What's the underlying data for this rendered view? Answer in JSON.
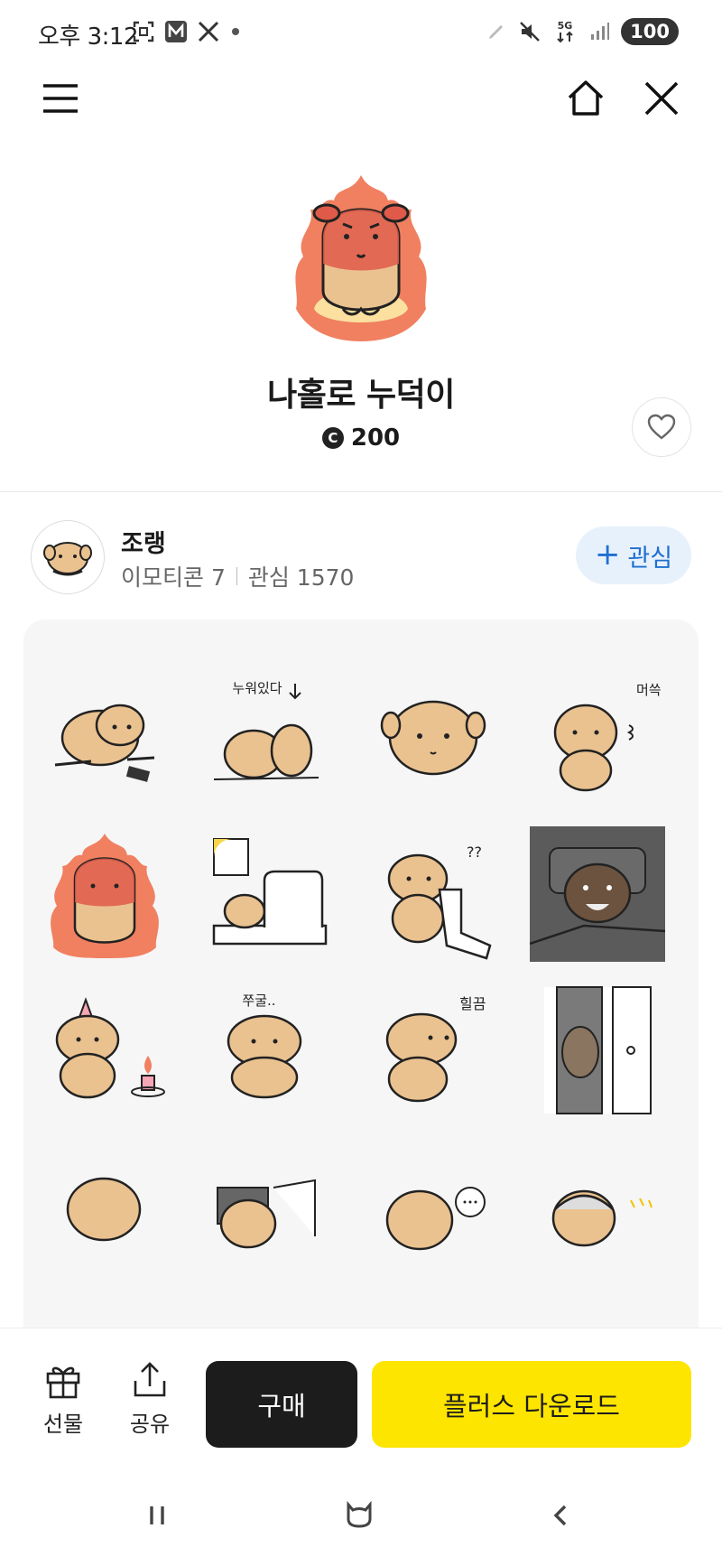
{
  "status_bar": {
    "time": "오후 3:12",
    "network": "5G",
    "battery": "100"
  },
  "product": {
    "title": "나홀로 누덕이",
    "price_icon": "C",
    "price": "200"
  },
  "creator": {
    "name": "조랭",
    "emoticon_count_label": "이모티콘 7",
    "follower_label": "관심 1570",
    "follow_button_label": "관심"
  },
  "stickers": {
    "cells": [
      {
        "icon": "puppy-lying-with-phone"
      },
      {
        "icon": "puppy-lying-down",
        "caption": "누워있다"
      },
      {
        "icon": "puppy-face"
      },
      {
        "icon": "puppy-sweating",
        "caption": "머쓱"
      },
      {
        "icon": "puppy-angry-fire"
      },
      {
        "icon": "puppy-in-bed-sun"
      },
      {
        "icon": "puppy-holding-sock",
        "caption": "??"
      },
      {
        "icon": "puppy-dark-room"
      },
      {
        "icon": "puppy-birthday-candle"
      },
      {
        "icon": "puppy-shrinking",
        "caption": "쭈굴.."
      },
      {
        "icon": "puppy-glancing",
        "caption": "힐끔"
      },
      {
        "icon": "puppy-in-doorway"
      },
      {
        "icon": "puppy-partial-1"
      },
      {
        "icon": "puppy-partial-2"
      },
      {
        "icon": "puppy-partial-3"
      },
      {
        "icon": "puppy-partial-4"
      }
    ]
  },
  "bottom_bar": {
    "gift_label": "선물",
    "share_label": "공유",
    "buy_label": "구매",
    "plus_download_label": "플러스 다운로드"
  },
  "colors": {
    "accent_yellow": "#FEE500",
    "follow_blue": "#1F6FD1",
    "puppy_fur": "#EAC290"
  }
}
